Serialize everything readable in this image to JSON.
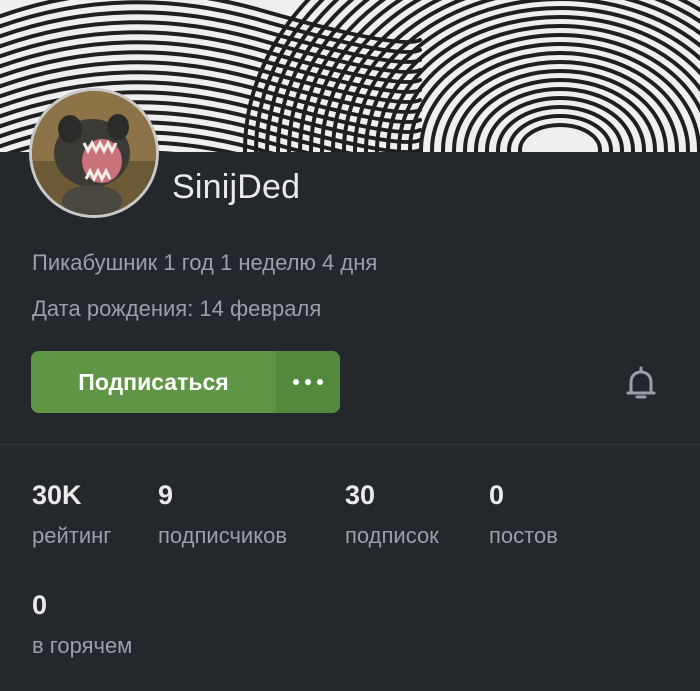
{
  "profile": {
    "username": "SinijDed",
    "member_for": "Пикабушник 1 год 1 неделю 4 дня",
    "birthday": "Дата рождения: 14 февраля"
  },
  "actions": {
    "subscribe_label": "Подписаться"
  },
  "stats": [
    {
      "value": "30K",
      "label": "рейтинг"
    },
    {
      "value": "9",
      "label": "подписчиков"
    },
    {
      "value": "30",
      "label": "подписок"
    },
    {
      "value": "0",
      "label": "постов"
    },
    {
      "value": "0",
      "label": "в горячем"
    }
  ],
  "colors": {
    "background": "#24282c",
    "accent": "#5e9645",
    "text_primary": "#eaeaea",
    "text_secondary": "#9aa0a6"
  },
  "icons": {
    "more": "more-dots-icon",
    "notifications": "bell-icon"
  }
}
